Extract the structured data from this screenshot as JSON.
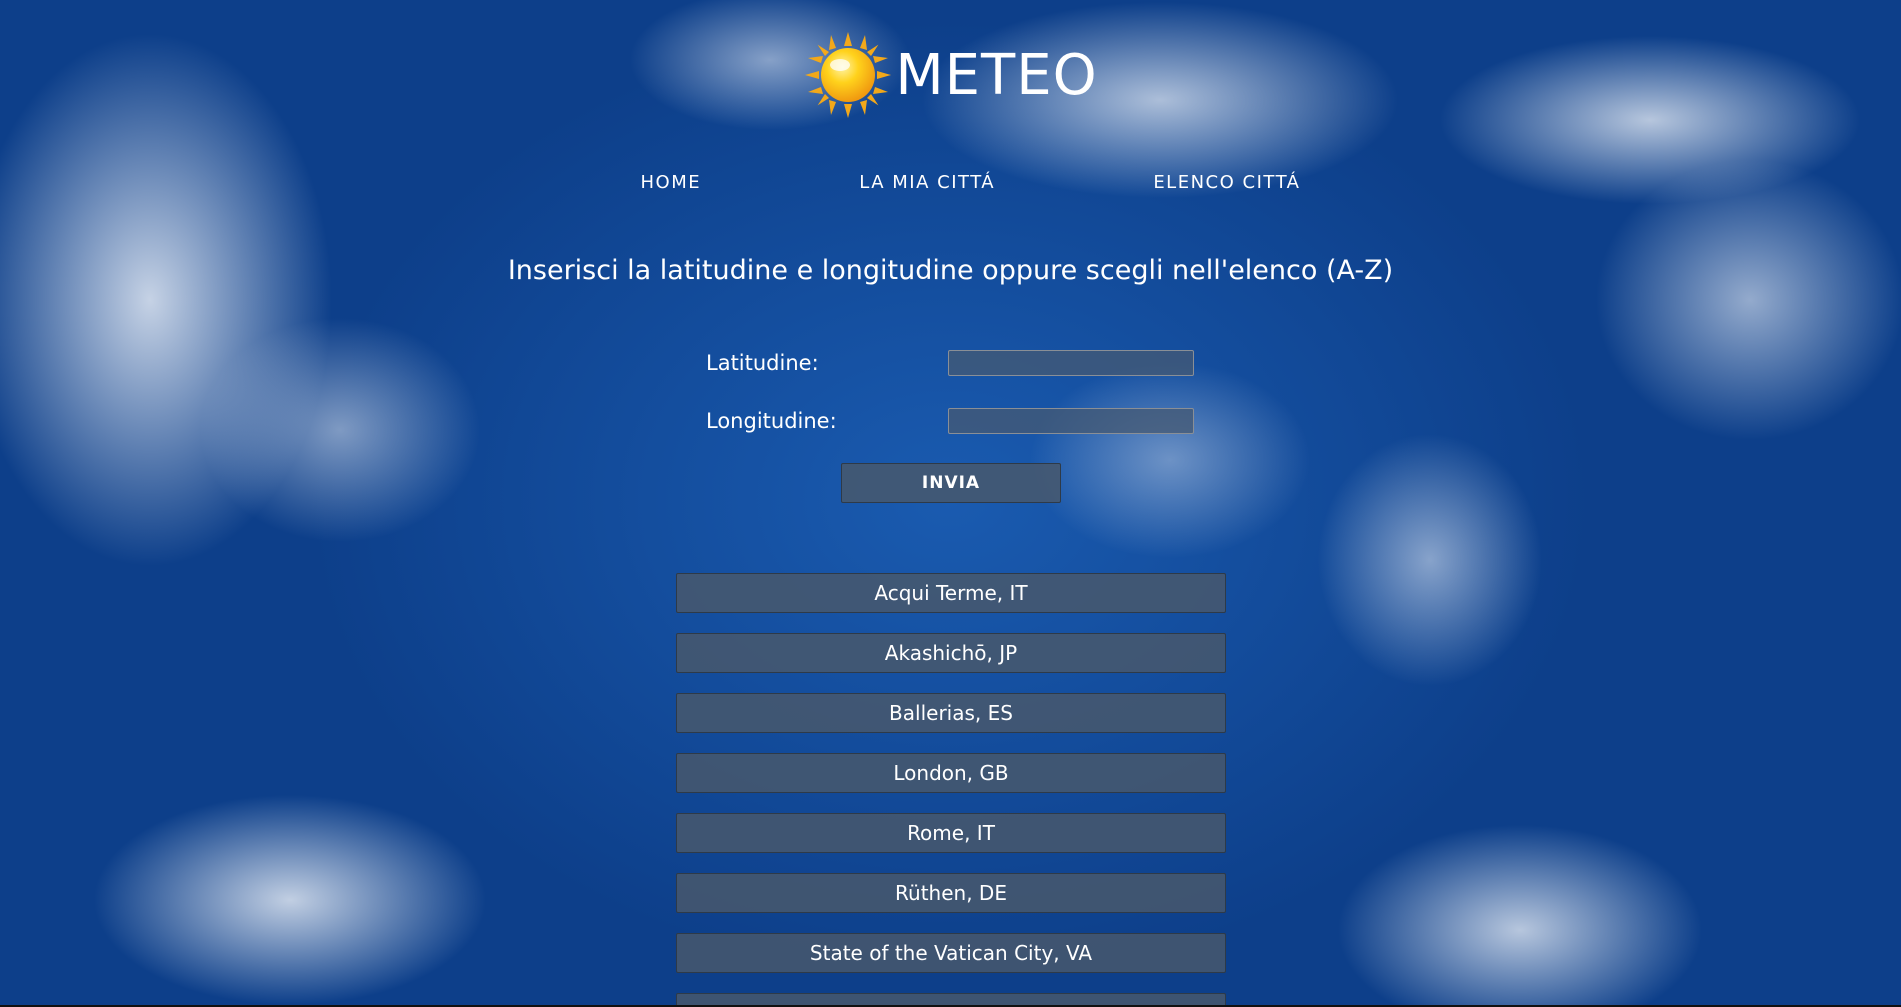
{
  "header": {
    "title": "METEO",
    "logo_icon": "sun-icon"
  },
  "nav": {
    "items": [
      {
        "label": "HOME"
      },
      {
        "label": "LA MIA CITTÁ"
      },
      {
        "label": "ELENCO CITTÁ"
      }
    ]
  },
  "main": {
    "instruction": "Inserisci la latitudine e longitudine oppure scegli nell'elenco (A-Z)",
    "form": {
      "latitude_label": "Latitudine:",
      "latitude_value": "",
      "longitude_label": "Longitudine:",
      "longitude_value": "",
      "submit_label": "INVIA"
    },
    "cities": [
      {
        "label": "Acqui Terme, IT"
      },
      {
        "label": "Akashichō, JP"
      },
      {
        "label": "Ballerias, ES"
      },
      {
        "label": "London, GB"
      },
      {
        "label": "Rome, IT"
      },
      {
        "label": "Rüthen, DE"
      },
      {
        "label": "State of the Vatican City, VA"
      },
      {
        "label": ""
      }
    ]
  },
  "colors": {
    "sky": "#1a5bb0",
    "button_bg": "#48586c",
    "sun": "#f5b21a"
  }
}
